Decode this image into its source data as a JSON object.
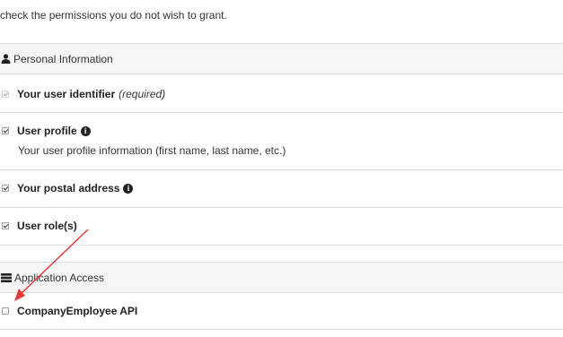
{
  "intro_text": "check the permissions you do not wish to grant.",
  "sections": {
    "personal": {
      "header": "Personal Information",
      "icon": "person-icon",
      "items": [
        {
          "title": "Your user identifier",
          "note": "(required)",
          "checked": true,
          "disabled": true
        },
        {
          "title": "User profile",
          "info": "i",
          "description": "Your user profile information (first name, last name, etc.)",
          "checked": true
        },
        {
          "title": "Your postal address",
          "info": "i",
          "checked": true
        },
        {
          "title": "User role(s)",
          "checked": true
        }
      ]
    },
    "application": {
      "header": "Application Access",
      "icon": "server-icon",
      "items": [
        {
          "title": "CompanyEmployee API",
          "checked": false
        }
      ]
    }
  },
  "colors": {
    "annotation_arrow": "#e53935",
    "header_bg": "#f5f5f5",
    "border": "#dddddd"
  }
}
